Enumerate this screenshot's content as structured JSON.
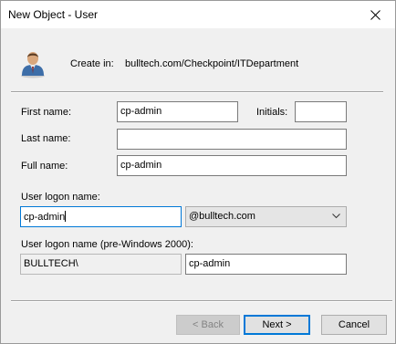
{
  "window": {
    "title": "New Object - User"
  },
  "header": {
    "icon": "user-icon",
    "create_in_label": "Create in:",
    "create_in_path": "bulltech.com/Checkpoint/ITDepartment"
  },
  "form": {
    "first_name": {
      "label": "First name:",
      "value": "cp-admin"
    },
    "initials": {
      "label": "Initials:",
      "value": ""
    },
    "last_name": {
      "label": "Last name:",
      "value": ""
    },
    "full_name": {
      "label": "Full name:",
      "value": "cp-admin"
    },
    "logon_name": {
      "label": "User logon name:",
      "value": "cp-admin"
    },
    "upn_suffix": {
      "selected": "@bulltech.com"
    },
    "pre2000": {
      "label": "User logon name (pre-Windows 2000):",
      "domain": "BULLTECH\\",
      "value": "cp-admin"
    }
  },
  "buttons": {
    "back": "< Back",
    "next": "Next >",
    "cancel": "Cancel"
  },
  "colors": {
    "focus": "#0078d7",
    "window_bg": "#f0f0f0"
  }
}
